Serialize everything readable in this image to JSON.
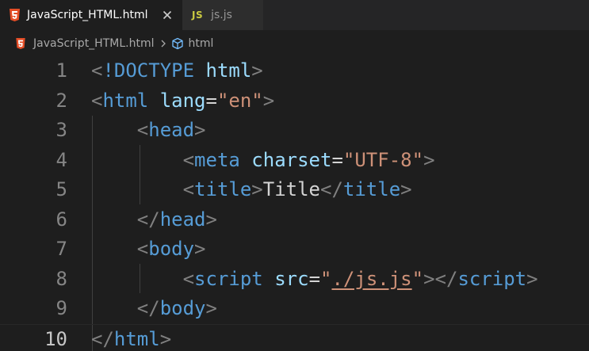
{
  "tabs": [
    {
      "label": "JavaScript_HTML.html",
      "icon": "html5-icon",
      "active": true
    },
    {
      "label": "js.js",
      "icon": "js-icon",
      "active": false
    }
  ],
  "breadcrumb": {
    "file": "JavaScript_HTML.html",
    "symbol": "html"
  },
  "js_badge": "JS",
  "colors": {
    "html5": "#e44d26",
    "js": "#cbcb41",
    "tag": "#569cd6",
    "attr": "#9cdcfe",
    "string": "#ce9178",
    "bracket": "#808080"
  },
  "editor": {
    "current_line": 10,
    "lines": [
      {
        "number": "1",
        "tokens": [
          [
            "t-bracket",
            "<"
          ],
          [
            "t-tag",
            "!DOCTYPE"
          ],
          [
            "t-text",
            " "
          ],
          [
            "t-attr",
            "html"
          ],
          [
            "t-bracket",
            ">"
          ]
        ]
      },
      {
        "number": "2",
        "tokens": [
          [
            "t-bracket",
            "<"
          ],
          [
            "t-tag",
            "html"
          ],
          [
            "t-text",
            " "
          ],
          [
            "t-attr",
            "lang"
          ],
          [
            "t-eq",
            "="
          ],
          [
            "t-str",
            "\"en\""
          ],
          [
            "t-bracket",
            ">"
          ]
        ]
      },
      {
        "number": "3",
        "tokens": [
          [
            "t-text",
            "    "
          ],
          [
            "t-bracket",
            "<"
          ],
          [
            "t-tag",
            "head"
          ],
          [
            "t-bracket",
            ">"
          ]
        ]
      },
      {
        "number": "4",
        "tokens": [
          [
            "t-text",
            "        "
          ],
          [
            "t-bracket",
            "<"
          ],
          [
            "t-tag",
            "meta"
          ],
          [
            "t-text",
            " "
          ],
          [
            "t-attr",
            "charset"
          ],
          [
            "t-eq",
            "="
          ],
          [
            "t-str",
            "\"UTF-8\""
          ],
          [
            "t-bracket",
            ">"
          ]
        ]
      },
      {
        "number": "5",
        "tokens": [
          [
            "t-text",
            "        "
          ],
          [
            "t-bracket",
            "<"
          ],
          [
            "t-tag",
            "title"
          ],
          [
            "t-bracket",
            ">"
          ],
          [
            "t-text",
            "Title"
          ],
          [
            "t-bracket",
            "</"
          ],
          [
            "t-tag",
            "title"
          ],
          [
            "t-bracket",
            ">"
          ]
        ]
      },
      {
        "number": "6",
        "tokens": [
          [
            "t-text",
            "    "
          ],
          [
            "t-bracket",
            "</"
          ],
          [
            "t-tag",
            "head"
          ],
          [
            "t-bracket",
            ">"
          ]
        ]
      },
      {
        "number": "7",
        "tokens": [
          [
            "t-text",
            "    "
          ],
          [
            "t-bracket",
            "<"
          ],
          [
            "t-tag",
            "body"
          ],
          [
            "t-bracket",
            ">"
          ]
        ]
      },
      {
        "number": "8",
        "tokens": [
          [
            "t-text",
            "        "
          ],
          [
            "t-bracket",
            "<"
          ],
          [
            "t-tag",
            "script"
          ],
          [
            "t-text",
            " "
          ],
          [
            "t-attr",
            "src"
          ],
          [
            "t-eq",
            "="
          ],
          [
            "t-str",
            "\""
          ],
          [
            "t-str t-link",
            "./js.js"
          ],
          [
            "t-str",
            "\""
          ],
          [
            "t-bracket",
            "></"
          ],
          [
            "t-tag",
            "script"
          ],
          [
            "t-bracket",
            ">"
          ]
        ]
      },
      {
        "number": "9",
        "tokens": [
          [
            "t-text",
            "    "
          ],
          [
            "t-bracket",
            "</"
          ],
          [
            "t-tag",
            "body"
          ],
          [
            "t-bracket",
            ">"
          ]
        ]
      },
      {
        "number": "10",
        "tokens": [
          [
            "t-bracket",
            "</"
          ],
          [
            "t-tag",
            "html"
          ],
          [
            "t-bracket",
            ">"
          ]
        ]
      }
    ]
  }
}
